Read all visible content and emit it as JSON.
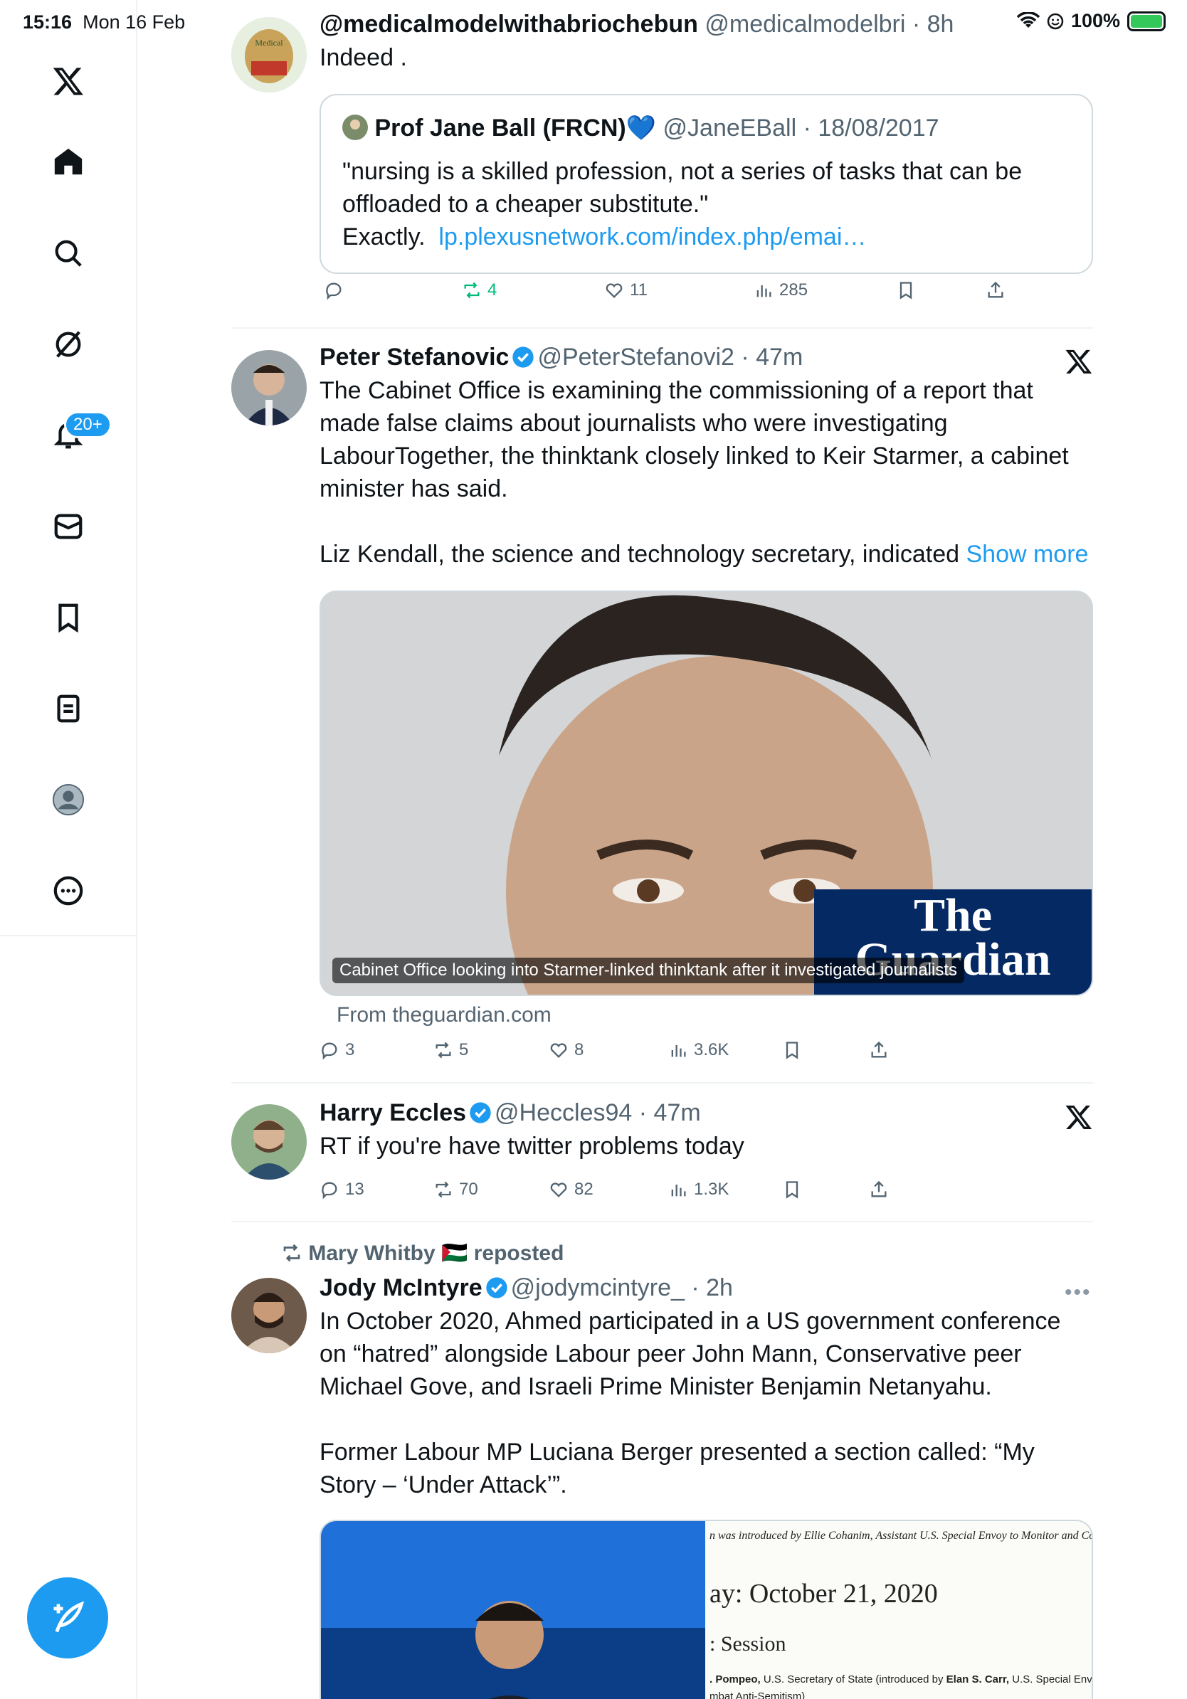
{
  "status_bar": {
    "time": "15:16",
    "date": "Mon 16 Feb",
    "battery": "100%"
  },
  "sidebar": {
    "notifications_badge": "20+"
  },
  "tweets": [
    {
      "name": "@medicalmodelwithabriochebun",
      "handle": "@medicalmodelbri",
      "time": "8h",
      "text": "Indeed .",
      "quote": {
        "name": "Prof Jane Ball (FRCN)",
        "heart": "💙",
        "handle": "@JaneEBall",
        "date": "18/08/2017",
        "text_1": "\"nursing is a skilled profession, not a series of tasks that can be offloaded to a cheaper substitute.\"",
        "text_2": "Exactly.",
        "link": "lp.plexusnetwork.com/index.php/emai…"
      },
      "replies": "",
      "reposts": "4",
      "likes": "11",
      "views": "285"
    },
    {
      "name": "Peter Stefanovic",
      "handle": "@PeterStefanovi2",
      "time": "47m",
      "text_1": "The Cabinet Office is examining the commissioning of a report that made false claims about journalists who were investigating LabourTogether, the thinktank closely linked to Keir Starmer, a cabinet minister has said.",
      "text_2": "Liz Kendall, the science and technology secretary, indicated",
      "show_more": "Show more",
      "card_caption": "Cabinet Office looking into Starmer-linked thinktank after it investigated journalists",
      "card_logo_1": "The",
      "card_logo_2": "Guardian",
      "from": "From theguardian.com",
      "replies": "3",
      "reposts": "5",
      "likes": "8",
      "views": "3.6K"
    },
    {
      "name": "Harry Eccles",
      "handle": "@Heccles94",
      "time": "47m",
      "text": "RT if you're have twitter problems today",
      "replies": "13",
      "reposts": "70",
      "likes": "82",
      "views": "1.3K"
    },
    {
      "reposted_by": "Mary Whitby 🇵🇸 reposted",
      "name": "Jody McIntyre",
      "handle": "@jodymcintyre_",
      "time": "2h",
      "text_1": "In October 2020, Ahmed participated in a US government conference on “hatred” alongside Labour peer John Mann, Conservative peer Michael Gove, and Israeli Prime Minister Benjamin Netanyahu.",
      "text_2": "Former Labour MP Luciana Berger presented a section called: “My Story – ‘Under Attack’”.",
      "doc_line_1": "n was introduced by Ellie Cohanim, Assistant U.S. Special Envoy to Monitor and Co",
      "doc_line_2": "ay: October 21, 2020",
      "doc_line_3": ": Session",
      "doc_line_4_a": ". Pompeo,",
      "doc_line_4_b": " U.S. Secretary of State (introduced by ",
      "doc_line_4_c": "Elan S. Carr,",
      "doc_line_4_d": " U.S. Special Env",
      "doc_line_5": "mbat Anti-Semitism)"
    }
  ],
  "colors": {
    "accent": "#1d9bf0",
    "repost_green": "#00ba7c",
    "muted": "#536471",
    "guardian": "#052962"
  }
}
